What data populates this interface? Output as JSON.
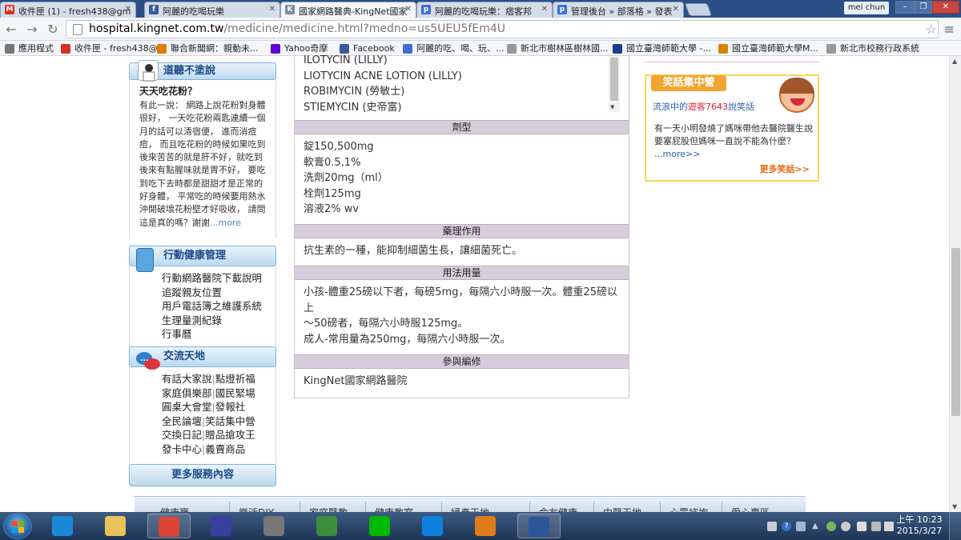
{
  "browser": {
    "tabs": [
      {
        "title": "收件匣 (1) - fresh438@gm",
        "favicon": "M",
        "color": "#d93025"
      },
      {
        "title": "阿麗的吃喝玩樂",
        "favicon": "f",
        "color": "#3b5998"
      },
      {
        "title": "國家網路醫典-KingNet國家",
        "favicon": "K",
        "color": "#7a8aa0"
      },
      {
        "title": "阿麗的吃喝玩樂：痞客邦",
        "favicon": "p",
        "color": "#3d6fd1"
      },
      {
        "title": "管理後台 » 部落格 » 發表",
        "favicon": "p",
        "color": "#3d6fd1"
      }
    ],
    "user": "mei chun",
    "window_controls": {
      "minimize": "–",
      "restore": "❐",
      "close": "✕"
    },
    "url_host": "hospital.kingnet.com.tw",
    "url_path": "/medicine/medicine.html?medno=us5UEU5fEm4U",
    "bookmarks": [
      {
        "label": "應用程式",
        "icon": "apps-icon",
        "color": "#777"
      },
      {
        "label": "收件匣 - fresh438@...",
        "icon": "gmail-icon",
        "color": "#d93025"
      },
      {
        "label": "聯合新聞網：親動未...",
        "icon": "udn-icon",
        "color": "#e07b00"
      },
      {
        "label": "Yahoo奇摩",
        "icon": "yahoo-icon",
        "color": "#5f01d1"
      },
      {
        "label": "Facebook",
        "icon": "facebook-icon",
        "color": "#3b5998"
      },
      {
        "label": "阿麗的吃、喝、玩、...",
        "icon": "pixnet-icon",
        "color": "#3d6fd1"
      },
      {
        "label": "新北市樹林區樹林國...",
        "icon": "page-icon",
        "color": "#999"
      },
      {
        "label": "國立臺灣師範大學 -...",
        "icon": "ntnu-seal-icon",
        "color": "#1e3a8a"
      },
      {
        "label": "國立臺灣師範大學M...",
        "icon": "m-logo-icon",
        "color": "#d98200"
      },
      {
        "label": "新北市校務行政系統",
        "icon": "page-icon",
        "color": "#999"
      }
    ]
  },
  "sidebar": {
    "qa": {
      "heading": "道聽不塗說",
      "title": "天天吃花粉？",
      "text": "有此一說： 網路上說花粉對身體很好， 一天吃花粉兩匙連續一個月的話可以清宿便， 進而消痘痘， 而且吃花粉的時候如果吃到後來苦苦的就是肝不好，就吃到後來有點腥味就是胃不好， 要吃到吃下去時都是甜甜才是正常的好身體， 平常吃的時候要用熱水沖開破壞花粉壁才好吸收， 請問這是真的嗎？謝謝",
      "more": "...more"
    },
    "mobile": {
      "heading": "行動健康管理",
      "items": [
        "行動網路醫院下載說明",
        "追蹤親友位置",
        "用戶電話簿之維護系統",
        "生理量測紀錄",
        "行事曆"
      ]
    },
    "community": {
      "heading": "交流天地",
      "rows": [
        [
          "有話大家說",
          "點燈祈福"
        ],
        [
          "家庭俱樂部",
          "國民緊場"
        ],
        [
          "圓桌大會堂",
          "發報社"
        ],
        [
          "全民論壇",
          "笑話集中營"
        ],
        [
          "交換日記",
          "贈品搶攻王"
        ],
        [
          "發卡中心",
          "義賣商品"
        ]
      ]
    },
    "more_services": "更多服務內容"
  },
  "medicine": {
    "brand_names": [
      "ILOTYCIN (LILLY)",
      "LIOTYCIN ACNE LOTION (LILLY)",
      "ROBIMYCIN (勞敏士)",
      "STIEMYCIN (史帝富)"
    ],
    "sections": [
      {
        "heading": "劑型",
        "lines": [
          "錠150,500mg",
          "軟膏0.5,1%",
          "洗劑20mg（ml）",
          "栓劑125mg",
          "溶液2% wv"
        ]
      },
      {
        "heading": "藥理作用",
        "lines": [
          "抗生素的一種，能抑制細菌生長，讓細菌死亡。"
        ]
      },
      {
        "heading": "用法用量",
        "lines": [
          "小孩-體重25磅以下者，每磅5mg，每隔六小時服一次。體重25磅以",
          "上",
          "～50磅者，每隔六小時服125mg。",
          "成人-常用量為250mg，每隔六小時服一次。"
        ]
      },
      {
        "heading": "參與編修",
        "lines": [
          "KingNet國家網路醫院"
        ]
      }
    ]
  },
  "joke_box": {
    "heading": "笑話集中營",
    "subtitle_prefix": "流浪中的",
    "subtitle_highlight": "遊客7643",
    "subtitle_suffix": "說笑話",
    "text": "有一天小明發燒了媽咪帶他去醫院醫生說要塞屁股但媽咪一直說不能為什麼？",
    "more": "more>>",
    "footer": "更多笑話>>"
  },
  "bottom_nav": [
    "健康寶",
    "樂活DIY",
    "家庭醫教",
    "健康教室",
    "婦產天地",
    "命友健康",
    "中醫天地",
    "心靈諮詢",
    "愛心專區"
  ],
  "taskbar": {
    "apps": [
      {
        "name": "ie",
        "icon": "internet-explorer-icon",
        "color": "#1e88d8",
        "running": false
      },
      {
        "name": "explorer",
        "icon": "folder-icon",
        "color": "#e8c35a",
        "running": false
      },
      {
        "name": "chrome",
        "icon": "chrome-icon",
        "color": "#db4437",
        "running": true
      },
      {
        "name": "save",
        "icon": "floppy-icon",
        "color": "#3b3f9e",
        "running": false
      },
      {
        "name": "app5",
        "icon": "ring-icon",
        "color": "#777",
        "running": false
      },
      {
        "name": "photo",
        "icon": "photo-icon",
        "color": "#3c8d3c",
        "running": false
      },
      {
        "name": "line",
        "icon": "line-icon",
        "color": "#00b900",
        "running": false
      },
      {
        "name": "dropbox",
        "icon": "dropbox-icon",
        "color": "#1081de",
        "running": false
      },
      {
        "name": "media",
        "icon": "media-player-icon",
        "color": "#e07b1a",
        "running": false
      },
      {
        "name": "word",
        "icon": "word-icon",
        "color": "#2b579a",
        "running": true
      }
    ],
    "clock_time": "上午 10:23",
    "clock_date": "2015/3/27"
  }
}
